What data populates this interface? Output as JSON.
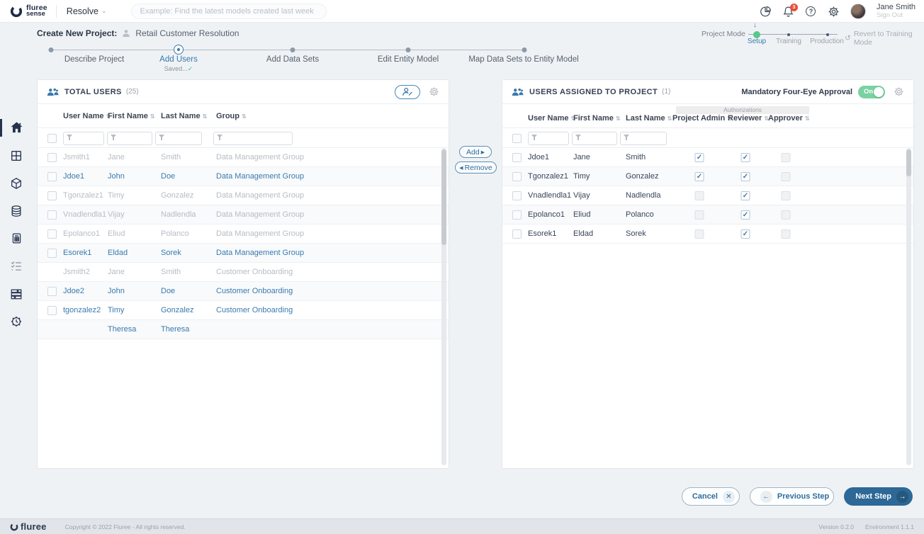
{
  "topbar": {
    "logo_line1": "fluree",
    "logo_line2": "sense",
    "nav_dropdown": "Resolve",
    "search_placeholder": "Example: Find the latest models created last week",
    "notification_count": "3",
    "user_name": "Jane Smith",
    "sign_out": "Sign Out"
  },
  "header": {
    "title_label": "Create New Project:",
    "project_name": "Retail Customer Resolution",
    "project_mode": {
      "label": "Project Mode",
      "options": [
        "Setup",
        "Training",
        "Production"
      ],
      "active": "Setup",
      "revert_link": "Revert to Training Mode"
    }
  },
  "stepper": {
    "steps": [
      {
        "label": "Describe Project",
        "state": "done"
      },
      {
        "label": "Add Users",
        "state": "active",
        "sublabel": "Saved..."
      },
      {
        "label": "Add Data Sets",
        "state": "todo"
      },
      {
        "label": "Edit Entity Model",
        "state": "todo"
      },
      {
        "label": "Map Data Sets to Entity Model",
        "state": "todo"
      }
    ]
  },
  "left_panel": {
    "title": "TOTAL USERS",
    "count": "(25)",
    "columns": [
      "User Name",
      "First Name",
      "Last Name",
      "Group"
    ],
    "rows": [
      {
        "user": "Jsmith1",
        "first": "Jane",
        "last": "Smith",
        "group": "Data Management Group",
        "style": "muted",
        "checkbox": true
      },
      {
        "user": "Jdoe1",
        "first": "John",
        "last": "Doe",
        "group": "Data Management Group",
        "style": "link",
        "checkbox": true
      },
      {
        "user": "Tgonzalez1",
        "first": "Timy",
        "last": "Gonzalez",
        "group": "Data Management Group",
        "style": "muted",
        "checkbox": true
      },
      {
        "user": "Vnadlendla1",
        "first": "Vijay",
        "last": "Nadlendla",
        "group": "Data Management Group",
        "style": "muted",
        "checkbox": true
      },
      {
        "user": "Epolanco1",
        "first": "Eliud",
        "last": "Polanco",
        "group": "Data Management Group",
        "style": "muted",
        "checkbox": true
      },
      {
        "user": "Esorek1",
        "first": "Eldad",
        "last": "Sorek",
        "group": "Data Management Group",
        "style": "link",
        "checkbox": true
      },
      {
        "user": "Jsmith2",
        "first": "Jane",
        "last": "Smith",
        "group": "Customer Onboarding",
        "style": "muted",
        "checkbox": false
      },
      {
        "user": "Jdoe2",
        "first": "John",
        "last": "Doe",
        "group": "Customer Onboarding",
        "style": "link",
        "checkbox": true
      },
      {
        "user": "tgonzalez2",
        "first": "Timy",
        "last": "Gonzalez",
        "group": "Customer Onboarding",
        "style": "link",
        "checkbox": true
      },
      {
        "user": "",
        "first": "Theresa",
        "last": "Theresa",
        "group": "",
        "style": "link",
        "checkbox": false
      }
    ]
  },
  "transfer": {
    "add_label": "Add",
    "remove_label": "Remove"
  },
  "right_panel": {
    "title": "USERS ASSIGNED TO PROJECT",
    "count": "(1)",
    "toggle_label": "Mandatory Four-Eye Approval",
    "toggle_state": "On",
    "auth_group_label": "Authorizations",
    "columns": [
      "User Name",
      "First Name",
      "Last Name",
      "Project Admin",
      "Reviewer",
      "Approver"
    ],
    "rows": [
      {
        "user": "Jdoe1",
        "first": "Jane",
        "last": "Smith",
        "project_admin": true,
        "reviewer": true,
        "approver": false
      },
      {
        "user": "Tgonzalez1",
        "first": "Timy",
        "last": "Gonzalez",
        "project_admin": true,
        "reviewer": true,
        "approver": false
      },
      {
        "user": "Vnadlendla1",
        "first": "Vijay",
        "last": "Nadlendla",
        "project_admin": false,
        "reviewer": true,
        "approver": false
      },
      {
        "user": "Epolanco1",
        "first": "Eliud",
        "last": "Polanco",
        "project_admin": false,
        "reviewer": true,
        "approver": false
      },
      {
        "user": "Esorek1",
        "first": "Eldad",
        "last": "Sorek",
        "project_admin": false,
        "reviewer": true,
        "approver": false
      }
    ]
  },
  "actions": {
    "cancel": "Cancel",
    "previous": "Previous Step",
    "next": "Next Step"
  },
  "footer": {
    "logo": "fluree",
    "copyright": "Copyright © 2022 Fluree - All rights reserved.",
    "version": "Version 0.2.0",
    "environment": "Environment 1.1.1"
  },
  "sidebar": {
    "items": [
      {
        "name": "home",
        "active": true
      },
      {
        "name": "grid",
        "active": false
      },
      {
        "name": "cube",
        "active": false
      },
      {
        "name": "database",
        "active": false
      },
      {
        "name": "report",
        "active": false
      },
      {
        "name": "checklist",
        "active": false
      },
      {
        "name": "layers",
        "active": false
      },
      {
        "name": "settings-history",
        "active": false
      }
    ]
  },
  "colors": {
    "accent_blue": "#3878ad",
    "link_blue": "#3a7ab0",
    "navy": "#25334d",
    "muted_gray": "#b7bcc4",
    "toggle_green": "#79d2a1",
    "mode_dot_green": "#57c98a",
    "badge_red": "#e8503a",
    "next_button": "#2d6896"
  }
}
